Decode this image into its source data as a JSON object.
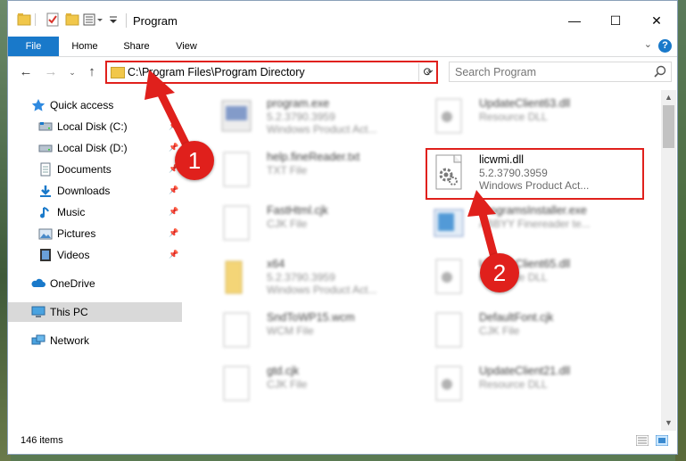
{
  "window": {
    "title": "Program",
    "minimize": "—",
    "maximize": "☐",
    "close": "✕"
  },
  "ribbon": {
    "tabs": [
      "File",
      "Home",
      "Share",
      "View"
    ],
    "help": "?"
  },
  "address": {
    "path": "C:\\Program Files\\Program Directory",
    "search_placeholder": "Search Program"
  },
  "sidebar": {
    "items": [
      {
        "label": "Quick access",
        "icon": "star-icon"
      },
      {
        "label": "Local Disk (C:)",
        "icon": "drive-icon"
      },
      {
        "label": "Local Disk (D:)",
        "icon": "drive-icon"
      },
      {
        "label": "Documents",
        "icon": "documents-icon"
      },
      {
        "label": "Downloads",
        "icon": "downloads-icon"
      },
      {
        "label": "Music",
        "icon": "music-icon"
      },
      {
        "label": "Pictures",
        "icon": "pictures-icon"
      },
      {
        "label": "Videos",
        "icon": "videos-icon"
      },
      {
        "label": "OneDrive",
        "icon": "cloud-icon"
      },
      {
        "label": "This PC",
        "icon": "computer-icon"
      },
      {
        "label": "Network",
        "icon": "network-icon"
      }
    ]
  },
  "files": {
    "col1": [
      {
        "name": "program.exe",
        "sub1": "5.2.3790.3959",
        "sub2": "Windows Product Act..."
      },
      {
        "name": "help.fineReader.txt",
        "sub1": "TXT File",
        "sub2": ""
      },
      {
        "name": "FastHtml.cjk",
        "sub1": "CJK File",
        "sub2": ""
      },
      {
        "name": "x64",
        "sub1": "5.2.3790.3959",
        "sub2": "Windows Product Act..."
      },
      {
        "name": "SndToWP15.wcm",
        "sub1": "WCM File",
        "sub2": ""
      },
      {
        "name": "gtd.cjk",
        "sub1": "CJK File",
        "sub2": ""
      }
    ],
    "col2": [
      {
        "name": "UpdateClient63.dll",
        "sub1": "Resource DLL",
        "sub2": ""
      },
      {
        "name": "licwmi.dll",
        "sub1": "5.2.3790.3959",
        "sub2": "Windows Product Act..."
      },
      {
        "name": "ProgramsInstaller.exe",
        "sub1": "ABBYY Finereader te...",
        "sub2": ""
      },
      {
        "name": "UpdateClient65.dll",
        "sub1": "Resource DLL",
        "sub2": ""
      },
      {
        "name": "DefaultFont.cjk",
        "sub1": "CJK File",
        "sub2": ""
      },
      {
        "name": "UpdateClient21.dll",
        "sub1": "Resource DLL",
        "sub2": ""
      }
    ]
  },
  "status": {
    "item_count": "146 items"
  },
  "annotations": {
    "step1": "1",
    "step2": "2",
    "color": "#e0201c"
  }
}
